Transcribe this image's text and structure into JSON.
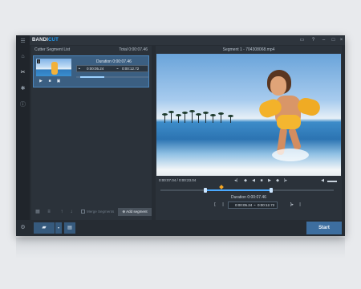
{
  "app": {
    "brand_main": "BANDI",
    "brand_accent": "CUT",
    "colors": {
      "accent": "#1ea2ff",
      "window_bg": "#262c33",
      "panel_bg": "#2b323a",
      "selected_segment": "#3b5f82",
      "button_blue": "#365a7d",
      "start_blue": "#3d6e9f",
      "playhead": "#f5a623"
    }
  },
  "window_controls": [
    "folder-icon",
    "help-icon",
    "minimize-icon",
    "maximize-icon",
    "close-icon"
  ],
  "left_panel": {
    "title": "Cutter Segment List",
    "total": "Total 0:00:07.46",
    "segments": [
      {
        "number": "1",
        "duration": "Duration 0:00:07.46",
        "start": "0:00:05.24",
        "separator": "~",
        "end": "0:00:12.72",
        "progress": 0.33
      }
    ],
    "merge_label": "Merge Segments",
    "add_segment_label": "Add segment"
  },
  "right_panel": {
    "title": "Segment 1 - 704308068.mp4",
    "time_readout": "0:00:07.04 / 0:00:23.04",
    "duration": "Duration 0:00:07.46",
    "range_start": "0:00:05.24",
    "range_separator": "~",
    "range_end": "0:00:12.72",
    "selection_start_fraction": 0.26,
    "selection_end_fraction": 0.64,
    "playhead_fraction": 0.35
  },
  "bottom": {
    "start_label": "Start"
  }
}
